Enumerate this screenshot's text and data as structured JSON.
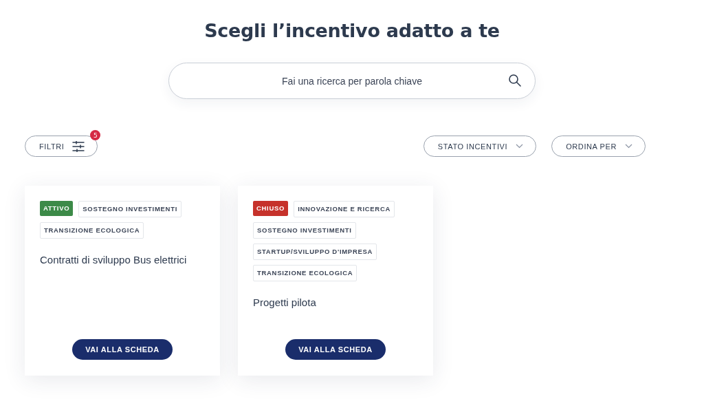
{
  "title": "Scegli l’incentivo adatto a te",
  "search": {
    "placeholder": "Fai una ricerca per parola chiave"
  },
  "filters": {
    "label": "FILTRI",
    "badge": "5"
  },
  "dropdowns": [
    {
      "label": "STATO INCENTIVI"
    },
    {
      "label": "ORDINA PER"
    }
  ],
  "cards": [
    {
      "status": {
        "label": "ATTIVO",
        "kind": "open"
      },
      "tags": [
        "SOSTEGNO INVESTIMENTI",
        "TRANSIZIONE ECOLOGICA"
      ],
      "title": "Contratti di sviluppo Bus elettrici",
      "button": "VAI ALLA SCHEDA"
    },
    {
      "status": {
        "label": "CHIUSO",
        "kind": "closed"
      },
      "tags": [
        "INNOVAZIONE E RICERCA",
        "SOSTEGNO INVESTIMENTI",
        "STARTUP/SVILUPPO D'IMPRESA",
        "TRANSIZIONE ECOLOGICA"
      ],
      "title": "Progetti pilota",
      "button": "VAI ALLA SCHEDA"
    }
  ]
}
